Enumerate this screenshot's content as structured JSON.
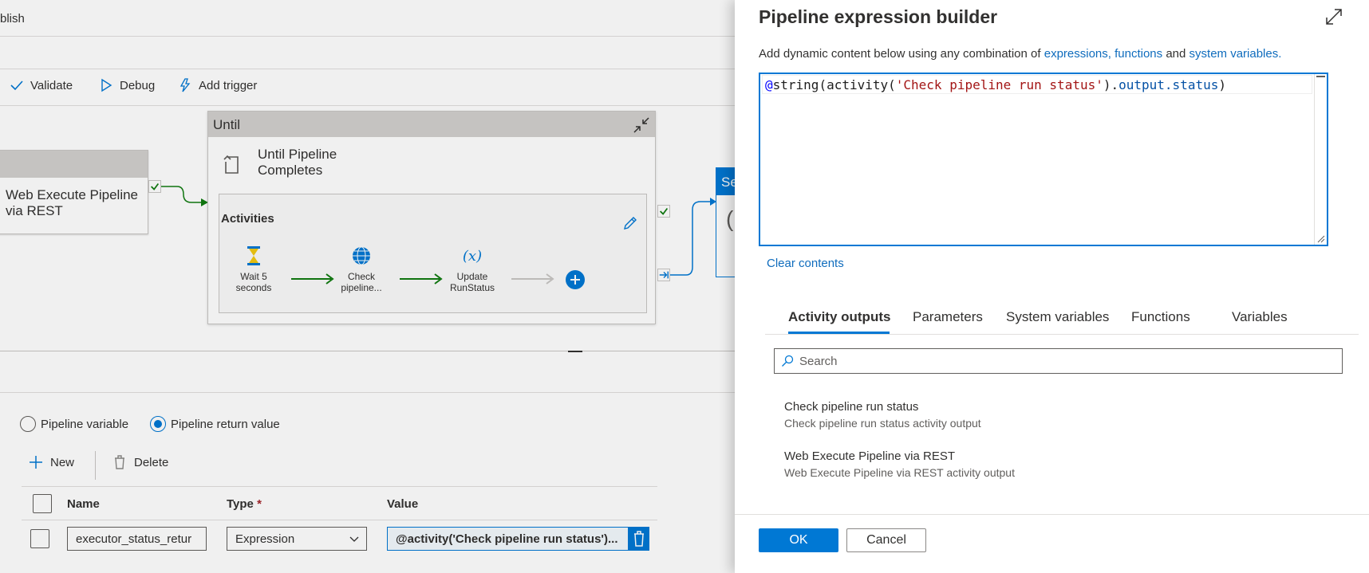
{
  "topbar": {
    "publish_label": "blish"
  },
  "toolbar": {
    "validate_label": "Validate",
    "debug_label": "Debug",
    "add_trigger_label": "Add trigger"
  },
  "canvas": {
    "web_card_label": "Web Execute Pipeline via REST",
    "until": {
      "header": "Until",
      "subtitle": "Until Pipeline Completes",
      "activities_title": "Activities",
      "activities": [
        {
          "label": "Wait 5 seconds",
          "icon": "hourglass-icon"
        },
        {
          "label": "Check pipeline...",
          "icon": "globe-icon"
        },
        {
          "label": "Update RunStatus",
          "icon": "variable-x-icon"
        }
      ]
    },
    "next_card_header": "Se"
  },
  "lower": {
    "radio_variable": "Pipeline variable",
    "radio_return": "Pipeline return value",
    "selected": "Pipeline return value",
    "new_label": "New",
    "delete_label": "Delete",
    "columns": {
      "name": "Name",
      "type": "Type",
      "required": "*",
      "value": "Value"
    },
    "row": {
      "name": "executor_status_retur",
      "type": "Expression",
      "value": "@activity('Check pipeline run status')..."
    }
  },
  "panel": {
    "title": "Pipeline expression builder",
    "desc_prefix": "Add dynamic content below using any combination of",
    "link_expressions": "expressions, functions",
    "desc_and": "and",
    "link_system": "system variables.",
    "expression": {
      "at": "@",
      "fn": "string(activity(",
      "str": "'Check pipeline run status'",
      "rest1": ").",
      "prop": "output.status",
      "rest2": ")"
    },
    "clear_label": "Clear contents",
    "tabs": [
      "Activity outputs",
      "Parameters",
      "System variables",
      "Functions",
      "Variables"
    ],
    "active_tab": "Activity outputs",
    "search_placeholder": "Search",
    "outputs": [
      {
        "title": "Check pipeline run status",
        "subtitle": "Check pipeline run status activity output"
      },
      {
        "title": "Web Execute Pipeline via REST",
        "subtitle": "Web Execute Pipeline via REST activity output"
      }
    ],
    "ok_label": "OK",
    "cancel_label": "Cancel"
  },
  "colors": {
    "accent": "#0078d4",
    "link": "#0f6cbd",
    "success": "#107c10"
  }
}
